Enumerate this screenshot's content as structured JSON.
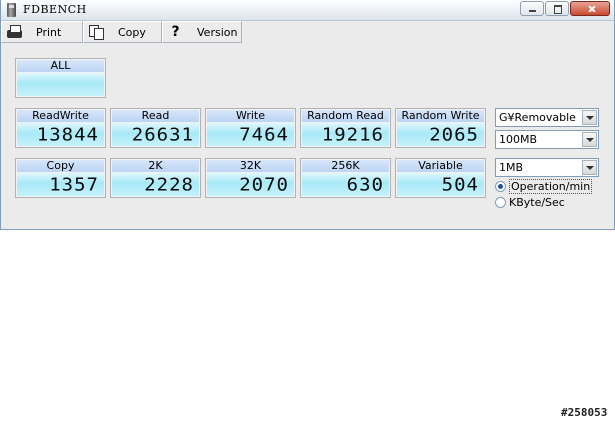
{
  "window": {
    "title": "FDBENCH"
  },
  "toolbar": {
    "print": "Print",
    "copy": "Copy",
    "version": "Version"
  },
  "tiles": {
    "all": {
      "label": "ALL",
      "value": ""
    },
    "readwrite": {
      "label": "ReadWrite",
      "value": "13844"
    },
    "read": {
      "label": "Read",
      "value": "26631"
    },
    "write": {
      "label": "Write",
      "value": "7464"
    },
    "random_read": {
      "label": "Random Read",
      "value": "19216"
    },
    "random_write": {
      "label": "Random Write",
      "value": "2065"
    },
    "copy": {
      "label": "Copy",
      "value": "1357"
    },
    "k2": {
      "label": "2K",
      "value": "2228"
    },
    "k32": {
      "label": "32K",
      "value": "2070"
    },
    "k256": {
      "label": "256K",
      "value": "630"
    },
    "variable": {
      "label": "Variable",
      "value": "504"
    }
  },
  "options": {
    "drive": "G¥Removable",
    "test_size": "100MB",
    "block_size": "1MB",
    "unit_operation": "Operation/min",
    "unit_kbyte": "KByte/Sec",
    "selected_unit": "Operation/min"
  },
  "footer": {
    "watermark": "#258053"
  }
}
